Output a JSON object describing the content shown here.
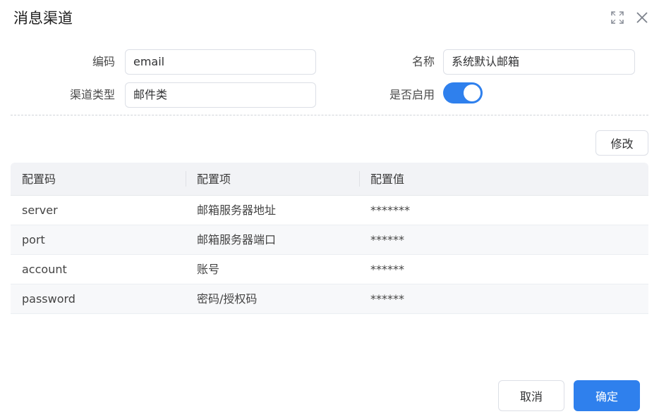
{
  "dialog": {
    "title": "消息渠道",
    "expand_icon": "fullscreen-icon",
    "close_icon": "close-icon"
  },
  "form": {
    "code_label": "编码",
    "code_value": "email",
    "name_label": "名称",
    "name_value": "系统默认邮箱",
    "type_label": "渠道类型",
    "type_value": "邮件类",
    "enabled_label": "是否启用",
    "enabled": true
  },
  "toolbar": {
    "edit_label": "修改"
  },
  "table": {
    "headers": [
      "配置码",
      "配置项",
      "配置值"
    ],
    "rows": [
      {
        "code": "server",
        "item": "邮箱服务器地址",
        "value": "*******"
      },
      {
        "code": "port",
        "item": "邮箱服务器端口",
        "value": "******"
      },
      {
        "code": "account",
        "item": "账号",
        "value": "******"
      },
      {
        "code": "password",
        "item": "密码/授权码",
        "value": "******"
      }
    ]
  },
  "footer": {
    "cancel_label": "取消",
    "confirm_label": "确定"
  },
  "colors": {
    "primary": "#2f80ed"
  }
}
